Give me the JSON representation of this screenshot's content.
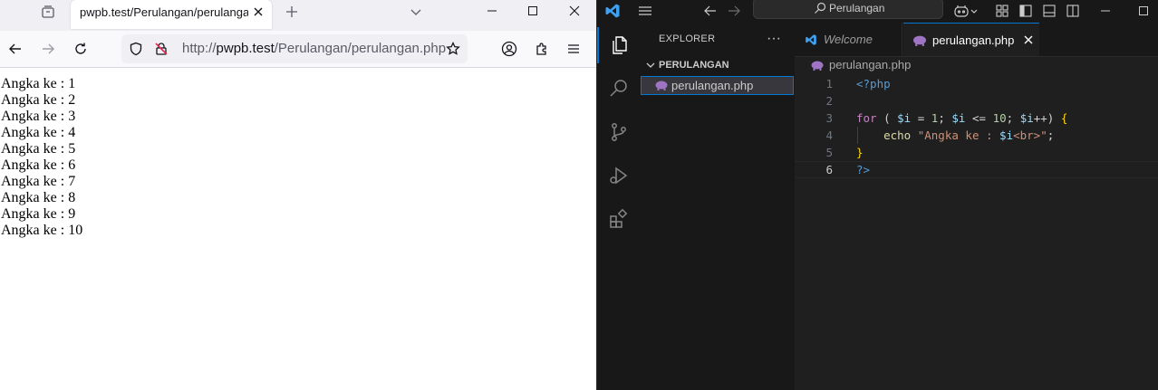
{
  "browser": {
    "tab": {
      "title": "pwpb.test/Perulangan/perulangan.php"
    },
    "url": {
      "scheme": "http://",
      "host": "pwpb.test",
      "path": "/Perulangan/perulangan.php"
    },
    "output_lines": [
      "Angka ke : 1",
      "Angka ke : 2",
      "Angka ke : 3",
      "Angka ke : 4",
      "Angka ke : 5",
      "Angka ke : 6",
      "Angka ke : 7",
      "Angka ke : 8",
      "Angka ke : 9",
      "Angka ke : 10"
    ]
  },
  "vscode": {
    "command_center": "Perulangan",
    "explorer": {
      "title": "EXPLORER",
      "more": "···",
      "folder": "PERULANGAN",
      "files": [
        "perulangan.php"
      ]
    },
    "tabs": [
      {
        "label": "Welcome",
        "active": false
      },
      {
        "label": "perulangan.php",
        "active": true
      }
    ],
    "breadcrumb": "perulangan.php",
    "code_lines": [
      {
        "no": "1",
        "tokens": [
          {
            "t": "<?php",
            "c": "tag"
          }
        ]
      },
      {
        "no": "2",
        "tokens": []
      },
      {
        "no": "3",
        "tokens": [
          {
            "t": "for",
            "c": "kw"
          },
          {
            "t": " ( ",
            "c": "op"
          },
          {
            "t": "$i",
            "c": "var"
          },
          {
            "t": " = ",
            "c": "op"
          },
          {
            "t": "1",
            "c": "num"
          },
          {
            "t": "; ",
            "c": "op"
          },
          {
            "t": "$i",
            "c": "var"
          },
          {
            "t": " <= ",
            "c": "op"
          },
          {
            "t": "10",
            "c": "num"
          },
          {
            "t": "; ",
            "c": "op"
          },
          {
            "t": "$i",
            "c": "var"
          },
          {
            "t": "++) ",
            "c": "op"
          },
          {
            "t": "{",
            "c": "brace"
          }
        ]
      },
      {
        "no": "4",
        "indent": true,
        "tokens": [
          {
            "t": "    echo ",
            "c": "fn"
          },
          {
            "t": "\"Angka ke : ",
            "c": "str"
          },
          {
            "t": "$i",
            "c": "var"
          },
          {
            "t": "<br>\"",
            "c": "str"
          },
          {
            "t": ";",
            "c": "op"
          }
        ]
      },
      {
        "no": "5",
        "tokens": [
          {
            "t": "}",
            "c": "brace"
          }
        ]
      },
      {
        "no": "6",
        "current": true,
        "tokens": [
          {
            "t": "?>",
            "c": "tag"
          }
        ]
      }
    ],
    "colors": {
      "accent": "#0078d4",
      "php_icon": "#a074c4",
      "vscode_logo": "#3ea1f2"
    }
  }
}
